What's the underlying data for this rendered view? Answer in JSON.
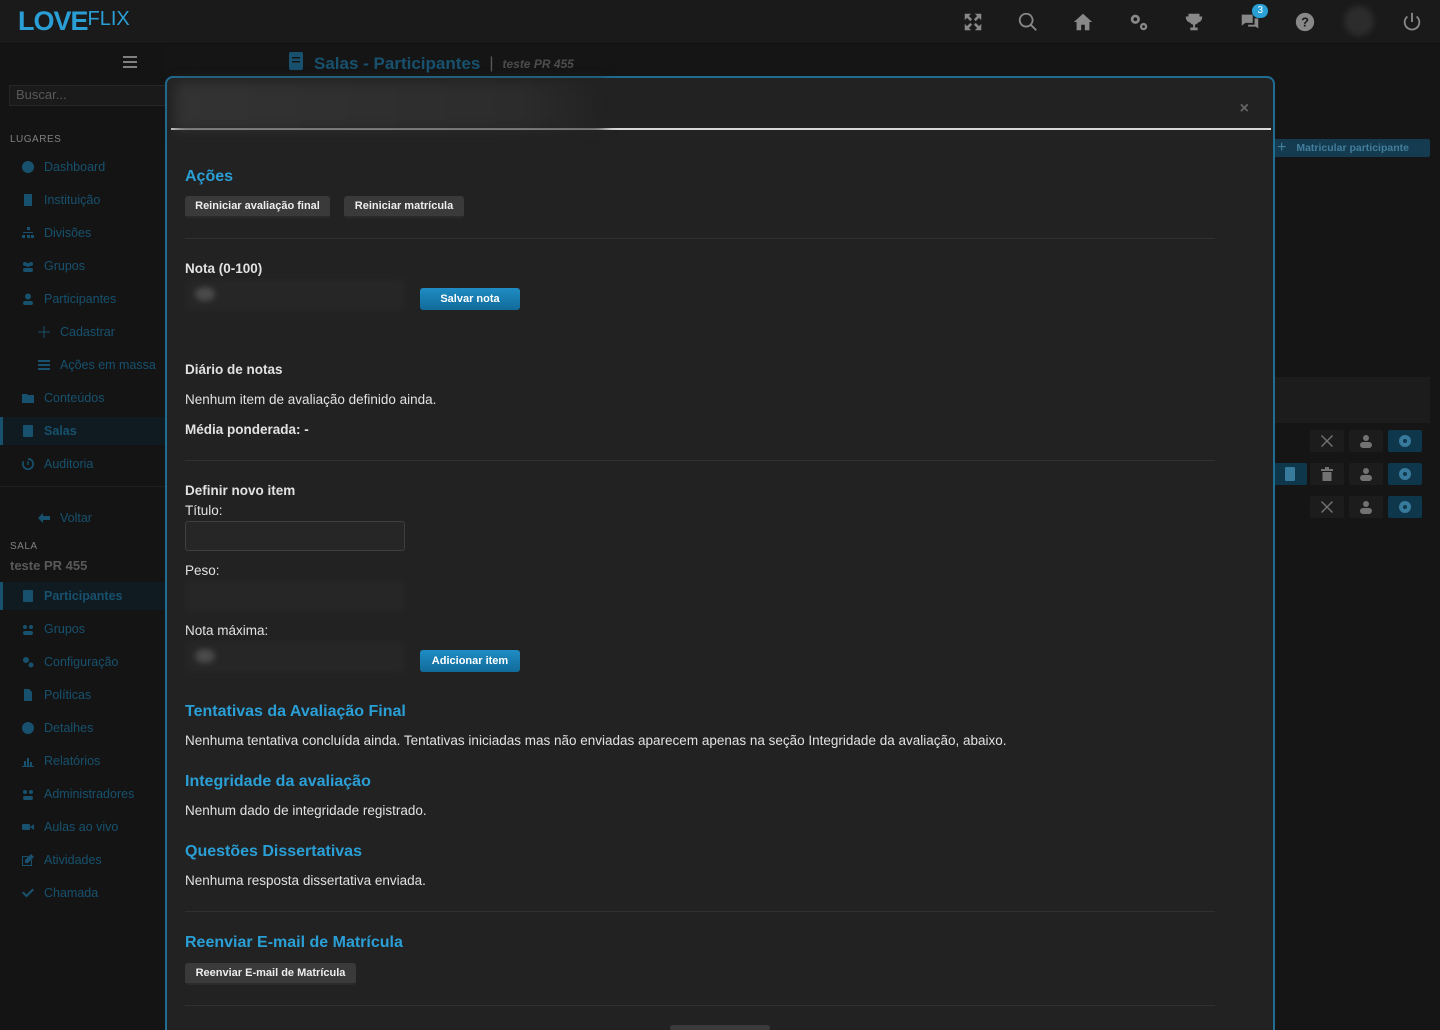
{
  "brand": {
    "logo_main": "LOVE",
    "logo_sub": "FLIX"
  },
  "topbar": {
    "icons": [
      "fullscreen-icon",
      "search-icon",
      "home-icon",
      "gears-icon",
      "trophy-icon",
      "chat-icon",
      "help-icon",
      "power-icon"
    ],
    "notif_count": "3"
  },
  "sidebar": {
    "search_placeholder": "Buscar...",
    "section_places": "LUGARES",
    "items": [
      {
        "label": "Dashboard",
        "icon": "dashboard-icon"
      },
      {
        "label": "Instituição",
        "icon": "building-icon"
      },
      {
        "label": "Divisões",
        "icon": "sitemap-icon"
      },
      {
        "label": "Grupos",
        "icon": "users-icon"
      },
      {
        "label": "Participantes",
        "icon": "user-icon"
      },
      {
        "label": "Cadastrar",
        "icon": "plus-icon"
      },
      {
        "label": "Ações em massa",
        "icon": "list-icon"
      },
      {
        "label": "Conteúdos",
        "icon": "folder-icon"
      },
      {
        "label": "Salas",
        "icon": "book-icon"
      },
      {
        "label": "Auditoria",
        "icon": "history-icon"
      }
    ],
    "back_label": "Voltar",
    "section_room": "SALA",
    "room_name": "teste PR 455",
    "room_items": [
      {
        "label": "Participantes",
        "icon": "book-icon"
      },
      {
        "label": "Grupos",
        "icon": "users-icon"
      },
      {
        "label": "Configuração",
        "icon": "cogs-icon"
      },
      {
        "label": "Políticas",
        "icon": "file-icon"
      },
      {
        "label": "Detalhes",
        "icon": "info-icon"
      },
      {
        "label": "Relatórios",
        "icon": "chart-icon"
      },
      {
        "label": "Administradores",
        "icon": "users-icon"
      },
      {
        "label": "Aulas ao vivo",
        "icon": "video-icon"
      },
      {
        "label": "Atividades",
        "icon": "edit-icon"
      },
      {
        "label": "Chamada",
        "icon": "check-icon"
      }
    ]
  },
  "header": {
    "title": "Salas - Participantes",
    "subtitle": "teste PR 455"
  },
  "background": {
    "enroll_button": "Matricular participante"
  },
  "modal": {
    "close": "×",
    "actions_title": "Ações",
    "btn_reset_final": "Reiniciar avaliação final",
    "btn_reset_enroll": "Reiniciar matrícula",
    "grade_label": "Nota (0-100)",
    "btn_save_grade": "Salvar nota",
    "diary_title": "Diário de notas",
    "diary_empty": "Nenhum item de avaliação definido ainda.",
    "weighted_avg": "Média ponderada: -",
    "new_item_title": "Definir novo item",
    "field_title": "Título:",
    "field_weight": "Peso:",
    "field_max": "Nota máxima:",
    "btn_add_item": "Adicionar item",
    "attempts_title": "Tentativas da Avaliação Final",
    "attempts_text": "Nenhuma tentativa concluída ainda. Tentativas iniciadas mas não enviadas aparecem apenas na seção Integridade da avaliação, abaixo.",
    "integrity_title": "Integridade da avaliação",
    "integrity_text": "Nenhum dado de integridade registrado.",
    "essay_title": "Questões Dissertativas",
    "essay_text": "Nenhuma resposta dissertativa enviada.",
    "resend_title": "Reenviar E-mail de Matrícula",
    "btn_resend": "Reenviar E-mail de Matrícula"
  }
}
